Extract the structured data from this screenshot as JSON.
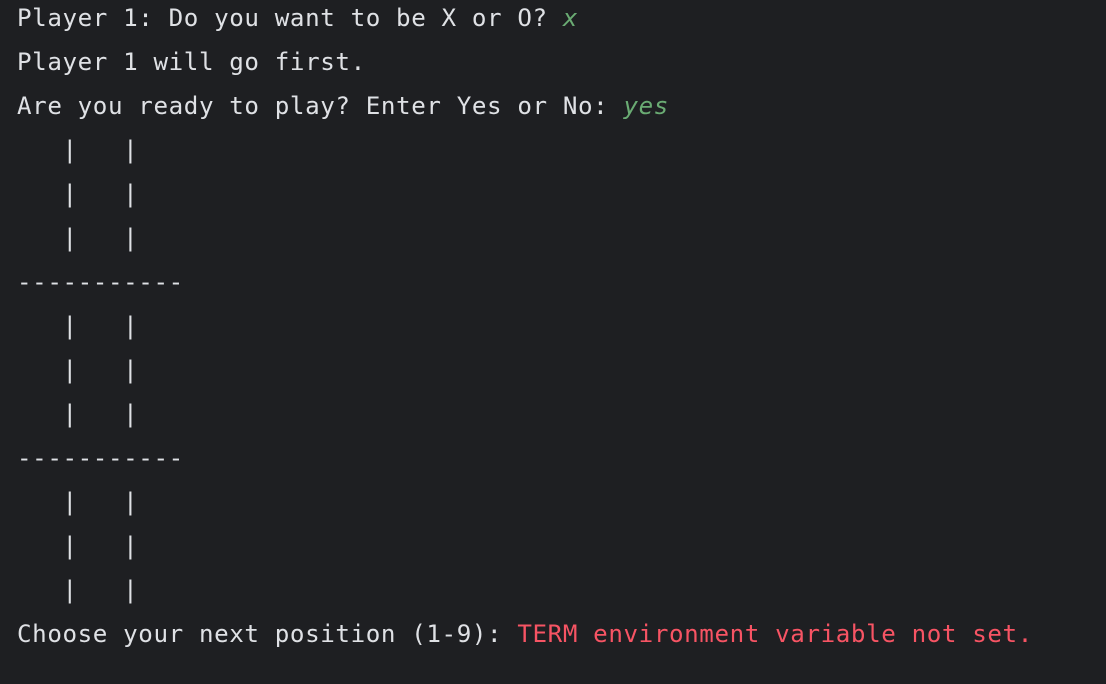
{
  "terminal": {
    "prompt_symbol": {
      "question": "Player 1: Do you want to be X or O? ",
      "answer": "x"
    },
    "first_player_msg": "Player 1 will go first.",
    "ready_prompt": {
      "question": "Are you ready to play? Enter Yes or No: ",
      "answer": "yes"
    },
    "board": {
      "cell_row": "   |   |",
      "separator": "-----------"
    },
    "position_prompt": "Choose your next position (1-9): ",
    "error_message": "TERM environment variable not set."
  },
  "colors": {
    "background": "#1e1f22",
    "text": "#dfe1e5",
    "user_input": "#6aab73",
    "error": "#f75464"
  }
}
